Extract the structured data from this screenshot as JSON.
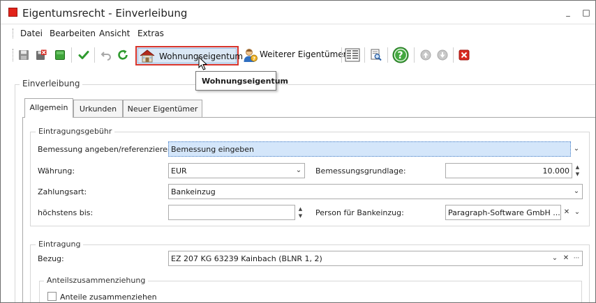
{
  "window": {
    "title": "Eigentumsrecht - Einverleibung",
    "minimize_glyph": "_",
    "maximize_glyph": "□"
  },
  "menu": [
    "Datei",
    "Bearbeiten",
    "Ansicht",
    "Extras"
  ],
  "toolbar": {
    "wohnung_label": "Wohnungseigentum",
    "weiter_label": "Weiterer Eigentümer?",
    "tooltip": "Wohnungseigentum"
  },
  "einverleibung": {
    "title": "Einverleibung"
  },
  "tabs": [
    "Allgemein",
    "Urkunden",
    "Neuer Eigentümer"
  ],
  "gebuehr": {
    "title": "Eintragungsgebühr",
    "bemessung_label": "Bemessung angeben/referenzieren:",
    "bemessung_value": "Bemessung eingeben",
    "waehrung_label": "Währung:",
    "waehrung_value": "EUR",
    "grundlage_label": "Bemessungsgrundlage:",
    "grundlage_value": "10.000",
    "zahlungsart_label": "Zahlungsart:",
    "zahlungsart_value": "Bankeinzug",
    "hoechstens_label": "höchstens bis:",
    "hoechstens_value": "",
    "person_label": "Person für Bankeinzug:",
    "person_value": "Paragraph-Software GmbH ..."
  },
  "eintragung": {
    "title": "Eintragung",
    "bezug_label": "Bezug:",
    "bezug_value": "EZ 207 KG 63239 Kainbach (BLNR 1, 2)",
    "anteil_title": "Anteilszusammenziehung",
    "anteil_checkbox_label": "Anteile zusammenziehen"
  },
  "glyphs": {
    "dropdown": "⌄",
    "clear": "✕",
    "more": "···",
    "spin_up": "▲",
    "spin_down": "▼"
  },
  "colors": {
    "highlight_border": "#d9342b",
    "selection": "#d4e6fa"
  }
}
